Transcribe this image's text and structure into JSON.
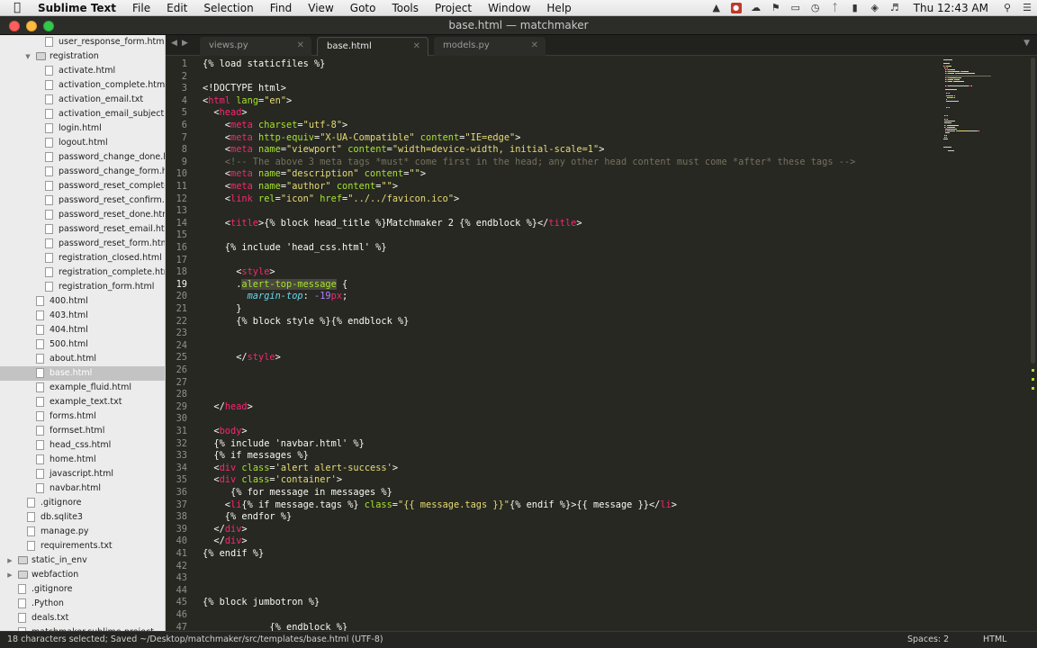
{
  "menubar": {
    "app_name": "Sublime Text",
    "items": [
      "File",
      "Edit",
      "Selection",
      "Find",
      "View",
      "Goto",
      "Tools",
      "Project",
      "Window",
      "Help"
    ],
    "clock": "Thu 12:43 AM",
    "status_icons": [
      "drive-icon",
      "record-icon",
      "cloud-icon",
      "notification-icon",
      "mirror-icon",
      "time-machine-icon",
      "bluetooth-icon",
      "battery-icon",
      "wifi-icon",
      "volume-icon",
      "search-icon",
      "list-icon"
    ]
  },
  "window": {
    "title": "base.html — matchmaker"
  },
  "sidebar": {
    "items": [
      {
        "label": "user_response_form.html",
        "depth": 2,
        "kind": "file"
      },
      {
        "label": "registration",
        "depth": 1,
        "kind": "folder",
        "expanded": true
      },
      {
        "label": "activate.html",
        "depth": 2,
        "kind": "file"
      },
      {
        "label": "activation_complete.html",
        "depth": 2,
        "kind": "file"
      },
      {
        "label": "activation_email.txt",
        "depth": 2,
        "kind": "file"
      },
      {
        "label": "activation_email_subject.txt",
        "depth": 2,
        "kind": "file"
      },
      {
        "label": "login.html",
        "depth": 2,
        "kind": "file"
      },
      {
        "label": "logout.html",
        "depth": 2,
        "kind": "file"
      },
      {
        "label": "password_change_done.html",
        "depth": 2,
        "kind": "file"
      },
      {
        "label": "password_change_form.html",
        "depth": 2,
        "kind": "file"
      },
      {
        "label": "password_reset_complete.html",
        "depth": 2,
        "kind": "file"
      },
      {
        "label": "password_reset_confirm.html",
        "depth": 2,
        "kind": "file"
      },
      {
        "label": "password_reset_done.html",
        "depth": 2,
        "kind": "file"
      },
      {
        "label": "password_reset_email.html",
        "depth": 2,
        "kind": "file"
      },
      {
        "label": "password_reset_form.html",
        "depth": 2,
        "kind": "file"
      },
      {
        "label": "registration_closed.html",
        "depth": 2,
        "kind": "file"
      },
      {
        "label": "registration_complete.html",
        "depth": 2,
        "kind": "file"
      },
      {
        "label": "registration_form.html",
        "depth": 2,
        "kind": "file"
      },
      {
        "label": "400.html",
        "depth": 1,
        "kind": "file"
      },
      {
        "label": "403.html",
        "depth": 1,
        "kind": "file"
      },
      {
        "label": "404.html",
        "depth": 1,
        "kind": "file"
      },
      {
        "label": "500.html",
        "depth": 1,
        "kind": "file"
      },
      {
        "label": "about.html",
        "depth": 1,
        "kind": "file"
      },
      {
        "label": "base.html",
        "depth": 1,
        "kind": "file",
        "selected": true
      },
      {
        "label": "example_fluid.html",
        "depth": 1,
        "kind": "file"
      },
      {
        "label": "example_text.txt",
        "depth": 1,
        "kind": "file"
      },
      {
        "label": "forms.html",
        "depth": 1,
        "kind": "file"
      },
      {
        "label": "formset.html",
        "depth": 1,
        "kind": "file"
      },
      {
        "label": "head_css.html",
        "depth": 1,
        "kind": "file"
      },
      {
        "label": "home.html",
        "depth": 1,
        "kind": "file"
      },
      {
        "label": "javascript.html",
        "depth": 1,
        "kind": "file"
      },
      {
        "label": "navbar.html",
        "depth": 1,
        "kind": "file"
      },
      {
        "label": ".gitignore",
        "depth": 0,
        "kind": "file"
      },
      {
        "label": "db.sqlite3",
        "depth": 0,
        "kind": "file"
      },
      {
        "label": "manage.py",
        "depth": 0,
        "kind": "file"
      },
      {
        "label": "requirements.txt",
        "depth": 0,
        "kind": "file"
      },
      {
        "label": "static_in_env",
        "depth": -1,
        "kind": "folder",
        "expanded": false
      },
      {
        "label": "webfaction",
        "depth": -1,
        "kind": "folder",
        "expanded": false
      },
      {
        "label": ".gitignore",
        "depth": -1,
        "kind": "file"
      },
      {
        "label": ".Python",
        "depth": -1,
        "kind": "file"
      },
      {
        "label": "deals.txt",
        "depth": -1,
        "kind": "file"
      },
      {
        "label": "matchmaker.sublime-project",
        "depth": -1,
        "kind": "file"
      }
    ]
  },
  "tabs": [
    {
      "label": "views.py",
      "active": false
    },
    {
      "label": "base.html",
      "active": true
    },
    {
      "label": "models.py",
      "active": false
    }
  ],
  "editor": {
    "current_line": 19,
    "lines": [
      {
        "n": "1",
        "segs": [
          [
            "p",
            "{% load staticfiles %}"
          ]
        ]
      },
      {
        "n": "2",
        "segs": []
      },
      {
        "n": "3",
        "segs": [
          [
            "p",
            "<!DOCTYPE html>"
          ]
        ]
      },
      {
        "n": "4",
        "segs": [
          [
            "p",
            "<"
          ],
          [
            "t",
            "html"
          ],
          [
            "a",
            " lang"
          ],
          [
            "p",
            "="
          ],
          [
            "s",
            "\"en\""
          ],
          [
            "p",
            ">"
          ]
        ]
      },
      {
        "n": "5",
        "segs": [
          [
            "p",
            "  <"
          ],
          [
            "t",
            "head"
          ],
          [
            "p",
            ">"
          ]
        ]
      },
      {
        "n": "6",
        "segs": [
          [
            "p",
            "    <"
          ],
          [
            "t",
            "meta"
          ],
          [
            "a",
            " charset"
          ],
          [
            "p",
            "="
          ],
          [
            "s",
            "\"utf-8\""
          ],
          [
            "p",
            ">"
          ]
        ]
      },
      {
        "n": "7",
        "segs": [
          [
            "p",
            "    <"
          ],
          [
            "t",
            "meta"
          ],
          [
            "a",
            " http-equiv"
          ],
          [
            "p",
            "="
          ],
          [
            "s",
            "\"X-UA-Compatible\""
          ],
          [
            "a",
            " content"
          ],
          [
            "p",
            "="
          ],
          [
            "s",
            "\"IE=edge\""
          ],
          [
            "p",
            ">"
          ]
        ]
      },
      {
        "n": "8",
        "segs": [
          [
            "p",
            "    <"
          ],
          [
            "t",
            "meta"
          ],
          [
            "a",
            " name"
          ],
          [
            "p",
            "="
          ],
          [
            "s",
            "\"viewport\""
          ],
          [
            "a",
            " content"
          ],
          [
            "p",
            "="
          ],
          [
            "s",
            "\"width=device-width, initial-scale=1\""
          ],
          [
            "p",
            ">"
          ]
        ]
      },
      {
        "n": "9",
        "segs": [
          [
            "c",
            "    <!-- The above 3 meta tags *must* come first in the head; any other head content must come *after* these tags -->"
          ]
        ]
      },
      {
        "n": "10",
        "segs": [
          [
            "p",
            "    <"
          ],
          [
            "t",
            "meta"
          ],
          [
            "a",
            " name"
          ],
          [
            "p",
            "="
          ],
          [
            "s",
            "\"description\""
          ],
          [
            "a",
            " content"
          ],
          [
            "p",
            "="
          ],
          [
            "s",
            "\"\""
          ],
          [
            "p",
            ">"
          ]
        ]
      },
      {
        "n": "11",
        "segs": [
          [
            "p",
            "    <"
          ],
          [
            "t",
            "meta"
          ],
          [
            "a",
            " name"
          ],
          [
            "p",
            "="
          ],
          [
            "s",
            "\"author\""
          ],
          [
            "a",
            " content"
          ],
          [
            "p",
            "="
          ],
          [
            "s",
            "\"\""
          ],
          [
            "p",
            ">"
          ]
        ]
      },
      {
        "n": "12",
        "segs": [
          [
            "p",
            "    <"
          ],
          [
            "t",
            "link"
          ],
          [
            "a",
            " rel"
          ],
          [
            "p",
            "="
          ],
          [
            "s",
            "\"icon\""
          ],
          [
            "a",
            " href"
          ],
          [
            "p",
            "="
          ],
          [
            "s",
            "\"../../favicon.ico\""
          ],
          [
            "p",
            ">"
          ]
        ]
      },
      {
        "n": "13",
        "segs": []
      },
      {
        "n": "14",
        "segs": [
          [
            "p",
            "    <"
          ],
          [
            "t",
            "title"
          ],
          [
            "p",
            ">{% block head_title %}Matchmaker 2 {% endblock %}</"
          ],
          [
            "t",
            "title"
          ],
          [
            "p",
            ">"
          ]
        ]
      },
      {
        "n": "15",
        "segs": []
      },
      {
        "n": "16",
        "segs": [
          [
            "p",
            "    {% include 'head_css.html' %}"
          ]
        ]
      },
      {
        "n": "17",
        "segs": []
      },
      {
        "n": "18",
        "segs": [
          [
            "p",
            "      <"
          ],
          [
            "t",
            "style"
          ],
          [
            "p",
            ">"
          ]
        ]
      },
      {
        "n": "19",
        "segs": [
          [
            "p",
            "      ."
          ],
          [
            "a",
            "alert-top-message"
          ],
          [
            "p",
            " {"
          ]
        ]
      },
      {
        "n": "20",
        "segs": [
          [
            "p",
            "        "
          ],
          [
            "i",
            "margin-top"
          ],
          [
            "p",
            ": "
          ],
          [
            "n",
            "-19"
          ],
          [
            "t",
            "px"
          ],
          [
            "p",
            ";"
          ]
        ]
      },
      {
        "n": "21",
        "segs": [
          [
            "p",
            "      }"
          ]
        ]
      },
      {
        "n": "22",
        "segs": [
          [
            "p",
            "      {% block style %}{% endblock %}"
          ]
        ]
      },
      {
        "n": "23",
        "segs": []
      },
      {
        "n": "24",
        "segs": []
      },
      {
        "n": "25",
        "segs": [
          [
            "p",
            "      </"
          ],
          [
            "t",
            "style"
          ],
          [
            "p",
            ">"
          ]
        ]
      },
      {
        "n": "26",
        "segs": []
      },
      {
        "n": "27",
        "segs": []
      },
      {
        "n": "28",
        "segs": []
      },
      {
        "n": "29",
        "segs": [
          [
            "p",
            "  </"
          ],
          [
            "t",
            "head"
          ],
          [
            "p",
            ">"
          ]
        ]
      },
      {
        "n": "30",
        "segs": []
      },
      {
        "n": "31",
        "segs": [
          [
            "p",
            "  <"
          ],
          [
            "t",
            "body"
          ],
          [
            "p",
            ">"
          ]
        ]
      },
      {
        "n": "32",
        "segs": [
          [
            "p",
            "  {% include 'navbar.html' %}"
          ]
        ]
      },
      {
        "n": "33",
        "segs": [
          [
            "p",
            "  {% if messages %}"
          ]
        ]
      },
      {
        "n": "34",
        "segs": [
          [
            "p",
            "  <"
          ],
          [
            "t",
            "div"
          ],
          [
            "a",
            " class"
          ],
          [
            "p",
            "="
          ],
          [
            "s",
            "'alert alert-success'"
          ],
          [
            "p",
            ">"
          ]
        ]
      },
      {
        "n": "35",
        "segs": [
          [
            "p",
            "  <"
          ],
          [
            "t",
            "div"
          ],
          [
            "a",
            " class"
          ],
          [
            "p",
            "="
          ],
          [
            "s",
            "'container'"
          ],
          [
            "p",
            ">"
          ]
        ]
      },
      {
        "n": "36",
        "segs": [
          [
            "p",
            "     {% for message in messages %}"
          ]
        ]
      },
      {
        "n": "37",
        "segs": [
          [
            "p",
            "    <"
          ],
          [
            "t",
            "li"
          ],
          [
            "p",
            "{% if message.tags %}"
          ],
          [
            "a",
            " class"
          ],
          [
            "p",
            "="
          ],
          [
            "s",
            "\"{{ message.tags }}\""
          ],
          [
            "p",
            "{% endif %}>{{ message }}</"
          ],
          [
            "t",
            "li"
          ],
          [
            "p",
            ">"
          ]
        ]
      },
      {
        "n": "38",
        "segs": [
          [
            "p",
            "    {% endfor %}"
          ]
        ]
      },
      {
        "n": "39",
        "segs": [
          [
            "p",
            "  </"
          ],
          [
            "t",
            "div"
          ],
          [
            "p",
            ">"
          ]
        ]
      },
      {
        "n": "40",
        "segs": [
          [
            "p",
            "  </"
          ],
          [
            "t",
            "div"
          ],
          [
            "p",
            ">"
          ]
        ]
      },
      {
        "n": "41",
        "segs": [
          [
            "p",
            "{% endif %}"
          ]
        ]
      },
      {
        "n": "42",
        "segs": []
      },
      {
        "n": "43",
        "segs": []
      },
      {
        "n": "44",
        "segs": []
      },
      {
        "n": "45",
        "segs": [
          [
            "p",
            "{% block jumbotron %}"
          ]
        ]
      },
      {
        "n": "46",
        "segs": []
      },
      {
        "n": "47",
        "segs": [
          [
            "p",
            "            {% endblock %}"
          ]
        ]
      }
    ]
  },
  "statusbar": {
    "message": "18 characters selected; Saved ~/Desktop/matchmaker/src/templates/base.html (UTF-8)",
    "spaces": "Spaces: 2",
    "syntax": "HTML"
  },
  "colors": {
    "editor_bg": "#272822",
    "tag": "#f92672",
    "attribute": "#a6e22e",
    "string": "#e6db74",
    "comment": "#75715e",
    "property": "#66d9ef",
    "number": "#ae81ff"
  }
}
